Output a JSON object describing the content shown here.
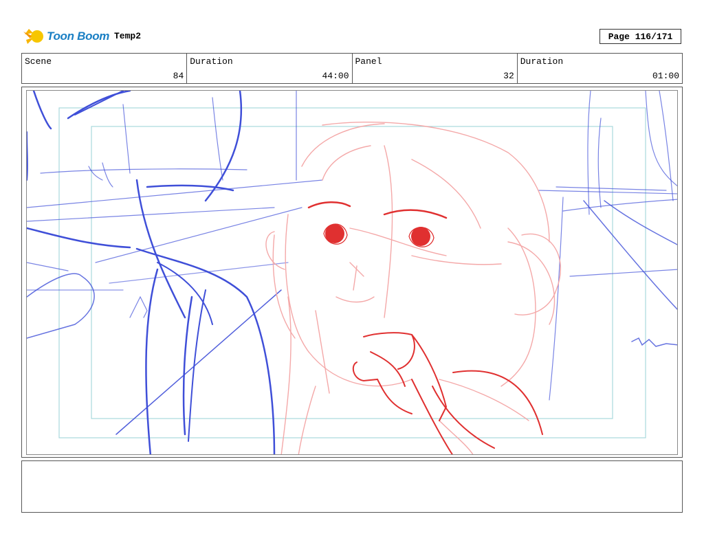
{
  "header": {
    "brand": "Toon Boom",
    "project_name": "Temp2",
    "page_label": "Page 116/171"
  },
  "info": {
    "scene_label": "Scene",
    "scene_value": "84",
    "scene_duration_label": "Duration",
    "scene_duration_value": "44:00",
    "panel_label": "Panel",
    "panel_value": "32",
    "panel_duration_label": "Duration",
    "panel_duration_value": "01:00"
  },
  "colors": {
    "background_sketch": "#3f4fd8",
    "character_rough": "#f4a8a8",
    "character_clean": "#e03030",
    "safe_frame": "#a8d8dc",
    "brand": "#1a7fc4"
  },
  "notes": {
    "text": ""
  }
}
